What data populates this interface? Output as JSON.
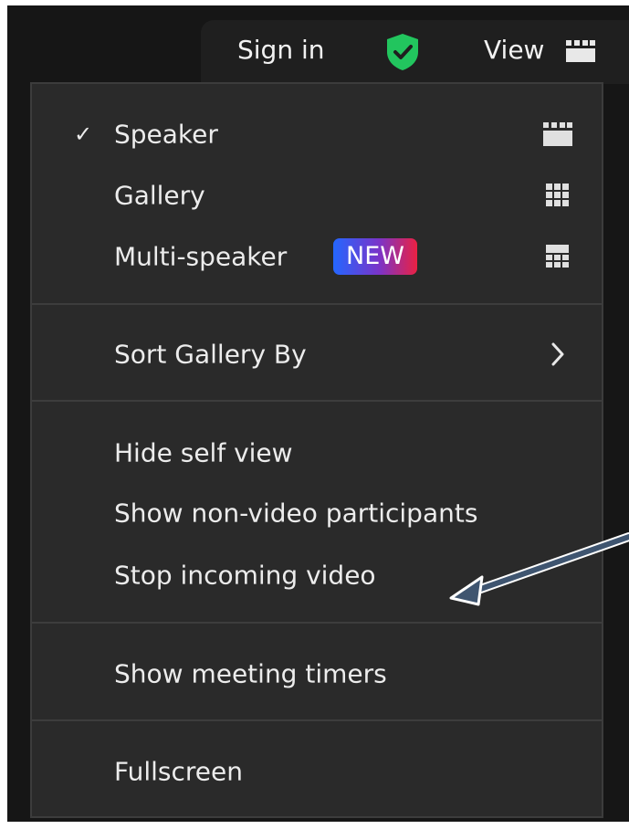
{
  "topbar": {
    "signin_label": "Sign in",
    "view_label": "View",
    "shield_icon": "shield-check-icon",
    "view_icon": "speaker-view-icon",
    "shield_color": "#22c55e"
  },
  "menu": {
    "group1": [
      {
        "label": "Speaker",
        "checked": true,
        "icon": "speaker-view-icon"
      },
      {
        "label": "Gallery",
        "checked": false,
        "icon": "gallery-grid-icon"
      },
      {
        "label": "Multi-speaker",
        "checked": false,
        "icon": "multi-speaker-icon",
        "badge": "NEW"
      }
    ],
    "check_glyph": "✓",
    "sort_label": "Sort Gallery By",
    "group3": [
      {
        "label": "Hide self view"
      },
      {
        "label": "Show non-video participants"
      },
      {
        "label": "Stop incoming video"
      }
    ],
    "timers_label": "Show meeting timers",
    "fullscreen_label": "Fullscreen"
  },
  "annotation": {
    "arrow_color": "#3f5570",
    "arrow_points_to": "Stop incoming video"
  }
}
